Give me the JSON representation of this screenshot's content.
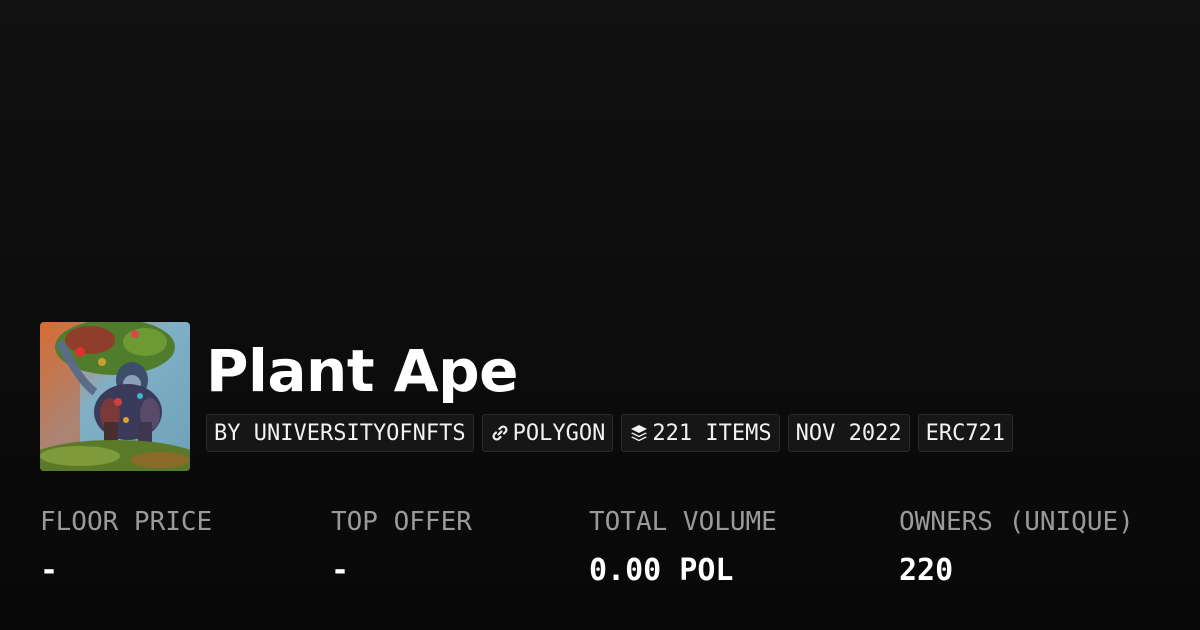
{
  "collection": {
    "name": "Plant Ape",
    "thumbnail_icon": "plant-ape-artwork"
  },
  "tags": [
    {
      "label": "BY UNIVERSITYOFNFTS"
    },
    {
      "label": "POLYGON",
      "icon": "link-icon"
    },
    {
      "label": "221 ITEMS",
      "icon": "layers-icon"
    },
    {
      "label": "NOV 2022"
    },
    {
      "label": "ERC721"
    }
  ],
  "stats": [
    {
      "label": "FLOOR PRICE",
      "value": "-"
    },
    {
      "label": "TOP OFFER",
      "value": "-"
    },
    {
      "label": "TOTAL VOLUME",
      "value": "0.00 POL"
    },
    {
      "label": "OWNERS (UNIQUE)",
      "value": "220"
    }
  ],
  "colors": {
    "background": "#0b0b0b",
    "tag_background": "#161616",
    "label_gray": "#9a9a9a"
  }
}
